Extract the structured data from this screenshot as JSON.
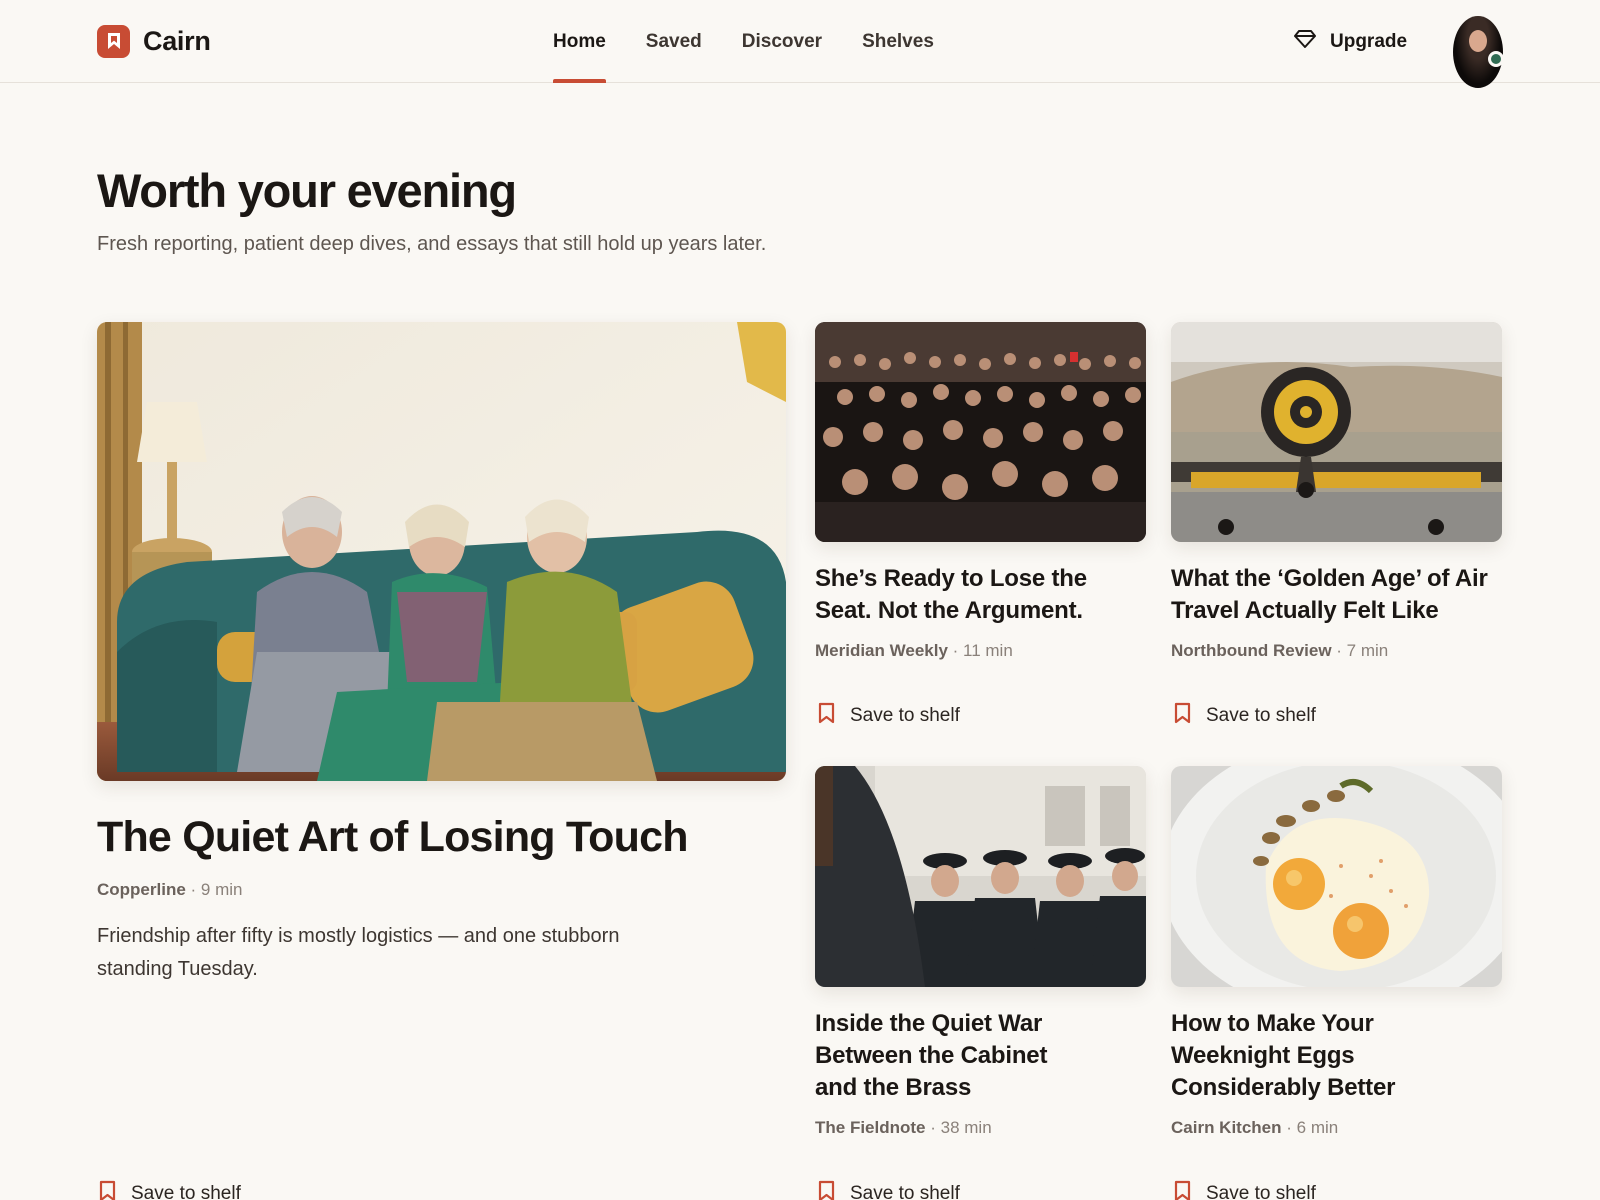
{
  "brand": {
    "name": "Cairn"
  },
  "nav": {
    "items": [
      {
        "label": "Home",
        "active": true
      },
      {
        "label": "Saved",
        "active": false
      },
      {
        "label": "Discover",
        "active": false
      },
      {
        "label": "Shelves",
        "active": false
      }
    ]
  },
  "header": {
    "upgrade_label": "Upgrade"
  },
  "hero": {
    "title": "Worth your evening",
    "subtitle": "Fresh reporting, patient deep dives, and essays that still hold up years later."
  },
  "featured": {
    "title": "The Quiet Art of Losing Touch",
    "publisher": "Copperline",
    "read_time": "· 9 min",
    "dek": "Friendship after fifty is mostly logistics — and one stubborn standing Tuesday.",
    "save_label": "Save to shelf"
  },
  "cards": [
    {
      "title": "She’s Ready to Lose the Seat. Not the Argument.",
      "publisher": "Meridian Weekly",
      "read_time": "· 11 min",
      "save_label": "Save to shelf"
    },
    {
      "title": "What the ‘Golden Age’ of Air Travel Actually Felt Like",
      "publisher": "Northbound Review",
      "read_time": "· 7 min",
      "save_label": "Save to shelf"
    },
    {
      "title": "Inside the Quiet War Between the Cabinet and the Brass",
      "publisher": "The Fieldnote",
      "read_time": "· 38 min",
      "save_label": "Save to shelf"
    },
    {
      "title": "How to Make Your Weeknight Eggs Considerably Better",
      "publisher": "Cairn Kitchen",
      "read_time": "· 6 min",
      "save_label": "Save to shelf"
    }
  ],
  "icons": {
    "brand": "bookmark-square-icon",
    "upgrade": "diamond-icon",
    "save": "bookmark-icon"
  },
  "colors": {
    "accent": "#c84c34",
    "background": "#faf8f4",
    "status_online": "#2f6b52"
  }
}
